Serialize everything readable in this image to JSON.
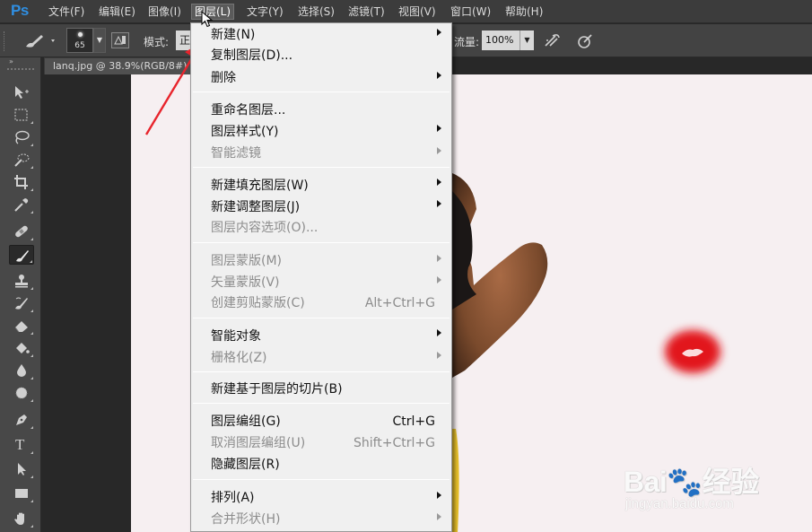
{
  "app": {
    "logo": "Ps",
    "accent_color": "#2f8fe3",
    "menu": [
      {
        "label": "文件(F)"
      },
      {
        "label": "编辑(E)"
      },
      {
        "label": "图像(I)"
      },
      {
        "label": "图层(L)",
        "active": true
      },
      {
        "label": "文字(Y)"
      },
      {
        "label": "选择(S)"
      },
      {
        "label": "滤镜(T)"
      },
      {
        "label": "视图(V)"
      },
      {
        "label": "窗口(W)"
      },
      {
        "label": "帮助(H)"
      }
    ]
  },
  "options_bar": {
    "brush_size": "65",
    "mode_label": "模式:",
    "mode_value": "正",
    "flow_label": "流量:",
    "flow_value": "100%",
    "icons": [
      "brush-tool-icon",
      "brush-panel-toggle-icon",
      "airbrush-icon",
      "pressure-size-icon"
    ]
  },
  "toolbar": {
    "collapse_glyph": "»",
    "tools": [
      {
        "name": "move-tool"
      },
      {
        "name": "marquee-tool"
      },
      {
        "name": "lasso-tool"
      },
      {
        "name": "quick-selection-tool"
      },
      {
        "name": "crop-tool"
      },
      {
        "name": "eyedropper-tool"
      },
      {
        "name": "healing-brush-tool"
      },
      {
        "name": "brush-tool",
        "selected": true
      },
      {
        "name": "clone-stamp-tool"
      },
      {
        "name": "history-brush-tool"
      },
      {
        "name": "eraser-tool"
      },
      {
        "name": "paint-bucket-tool"
      },
      {
        "name": "blur-tool"
      },
      {
        "name": "dodge-tool"
      },
      {
        "name": "pen-tool"
      },
      {
        "name": "type-tool",
        "glyph": "T"
      },
      {
        "name": "path-selection-tool"
      },
      {
        "name": "rectangle-tool"
      },
      {
        "name": "hand-tool"
      }
    ]
  },
  "document": {
    "tab_title": "lanq.jpg @ 38.9%(RGB/8#)",
    "canvas_color": "#f6eff1"
  },
  "layer_menu": {
    "items": [
      {
        "label": "新建(N)",
        "submenu": true
      },
      {
        "label": "复制图层(D)..."
      },
      {
        "label": "删除",
        "submenu": true
      },
      {
        "separator": true
      },
      {
        "label": "重命名图层..."
      },
      {
        "label": "图层样式(Y)",
        "submenu": true
      },
      {
        "label": "智能滤镜",
        "submenu": true,
        "disabled": true
      },
      {
        "separator": true
      },
      {
        "label": "新建填充图层(W)",
        "submenu": true
      },
      {
        "label": "新建调整图层(J)",
        "submenu": true
      },
      {
        "label": "图层内容选项(O)...",
        "disabled": true
      },
      {
        "separator": true
      },
      {
        "label": "图层蒙版(M)",
        "submenu": true,
        "disabled": true
      },
      {
        "label": "矢量蒙版(V)",
        "submenu": true,
        "disabled": true
      },
      {
        "label": "创建剪贴蒙版(C)",
        "shortcut": "Alt+Ctrl+G",
        "disabled": true
      },
      {
        "separator": true
      },
      {
        "label": "智能对象",
        "submenu": true
      },
      {
        "label": "栅格化(Z)",
        "submenu": true,
        "disabled": true
      },
      {
        "separator": true
      },
      {
        "label": "新建基于图层的切片(B)"
      },
      {
        "separator": true
      },
      {
        "label": "图层编组(G)",
        "shortcut": "Ctrl+G"
      },
      {
        "label": "取消图层编组(U)",
        "shortcut": "Shift+Ctrl+G",
        "disabled": true
      },
      {
        "label": "隐藏图层(R)"
      },
      {
        "separator": true
      },
      {
        "label": "排列(A)",
        "submenu": true
      },
      {
        "label": "合并形状(H)",
        "submenu": true,
        "disabled": true
      }
    ]
  },
  "watermark": {
    "main": "Bai🐾经验",
    "sub": "jingyan.baidu.com"
  },
  "annotation": {
    "arrow_color": "#e8242c"
  }
}
